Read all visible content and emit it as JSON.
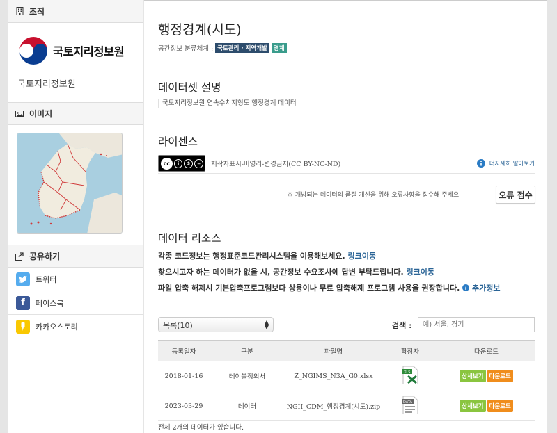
{
  "sidebar": {
    "org_header": "조직",
    "org_logo_text": "국토지리정보원",
    "org_name": "국토지리정보원",
    "image_header": "이미지",
    "share_header": "공유하기",
    "share_items": [
      {
        "label": "트위터",
        "color": "#55acee",
        "glyph": "🐦"
      },
      {
        "label": "페이스북",
        "color": "#3b5998",
        "glyph": "f"
      },
      {
        "label": "카카오스토리",
        "color": "#f9c802",
        "glyph": "❜"
      }
    ]
  },
  "main": {
    "title": "행정경계(시도)",
    "classification_label": "공간정보 분류체계 :",
    "tags": [
      {
        "label": "국토관리 · 지역개발",
        "color": "#2d4c6c"
      },
      {
        "label": "경계",
        "color": "#3a9c8c"
      }
    ],
    "description_heading": "데이터셋 설명",
    "description": "국토지리정보원 연속수치지형도 행정경계 데이터",
    "license_heading": "라이센스",
    "license_badge": {
      "cc": "cc",
      "by": "BY",
      "nc": "NC",
      "nd": "ND"
    },
    "license_text": "저작자표시-비영리-변경금지(CC BY-NC-ND)",
    "license_more": "더자세히 알아보기",
    "error_notice": "※ 개방되는 데이터의 품질 개선을 위해 오류사항을 접수해 주세요",
    "error_button": "오류 접수",
    "resources_heading": "데이터 리소스",
    "info_lines": [
      {
        "text": "각종 코드정보는 행정표준코드관리시스템을 이용해보세요.",
        "link": "링크이동"
      },
      {
        "text": "찾으시고자 하는 데이터가 없을 시, 공간정보 수요조사에 답변 부탁드립니다.",
        "link": "링크이동"
      },
      {
        "text": "파일 압축 해제시 기본압축프로그램보다 상용이나 무료 압축해제 프로그램 사용을 권장합니다.",
        "link": "추가정보"
      }
    ],
    "list_select": "목록(10)",
    "search_label": "검색 :",
    "search_placeholder": "예) 서울, 경기",
    "table": {
      "headers": [
        "등록일자",
        "구분",
        "파일명",
        "확장자",
        "다운로드"
      ],
      "rows": [
        {
          "date": "2018-01-16",
          "type": "테이블정의서",
          "file": "Z_NGIMS_N3A_G0.xlsx",
          "ext": "XLS"
        },
        {
          "date": "2023-03-29",
          "type": "데이터",
          "file": "NGII_CDM_행정경계(시도).zip",
          "ext": "DATA"
        }
      ],
      "detail_label": "상세보기",
      "download_label": "다운로드"
    },
    "total_text": "전체 2개의 데이터가 있습니다."
  },
  "colors": {
    "detail_button": "#8ac53f",
    "download_button": "#f08d1c",
    "link": "#2a6496"
  }
}
